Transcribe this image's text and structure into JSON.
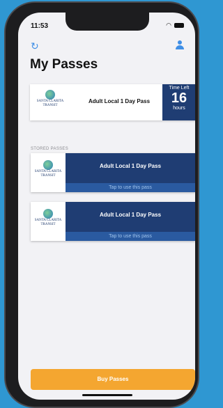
{
  "status": {
    "time": "11:53"
  },
  "header": {
    "title": "My Passes"
  },
  "logo": {
    "line1": "SANTA CLARITA",
    "line2": "TRANSIT"
  },
  "active_pass": {
    "name": "Adult Local 1 Day Pass",
    "time_left_label": "Time Left",
    "time_left_value": "16",
    "time_left_unit": "hours"
  },
  "stored": {
    "section_label": "STORED PASSES",
    "items": [
      {
        "name": "Adult Local 1 Day Pass",
        "action": "Tap to use this pass"
      },
      {
        "name": "Adult Local 1 Day Pass",
        "action": "Tap to use this pass"
      }
    ]
  },
  "buy_button": {
    "label": "Buy Passes"
  },
  "colors": {
    "accent": "#f4a630",
    "navy": "#1f3d73",
    "link": "#3f8fe6"
  },
  "icons": {
    "refresh": "refresh-icon",
    "profile": "profile-icon"
  }
}
